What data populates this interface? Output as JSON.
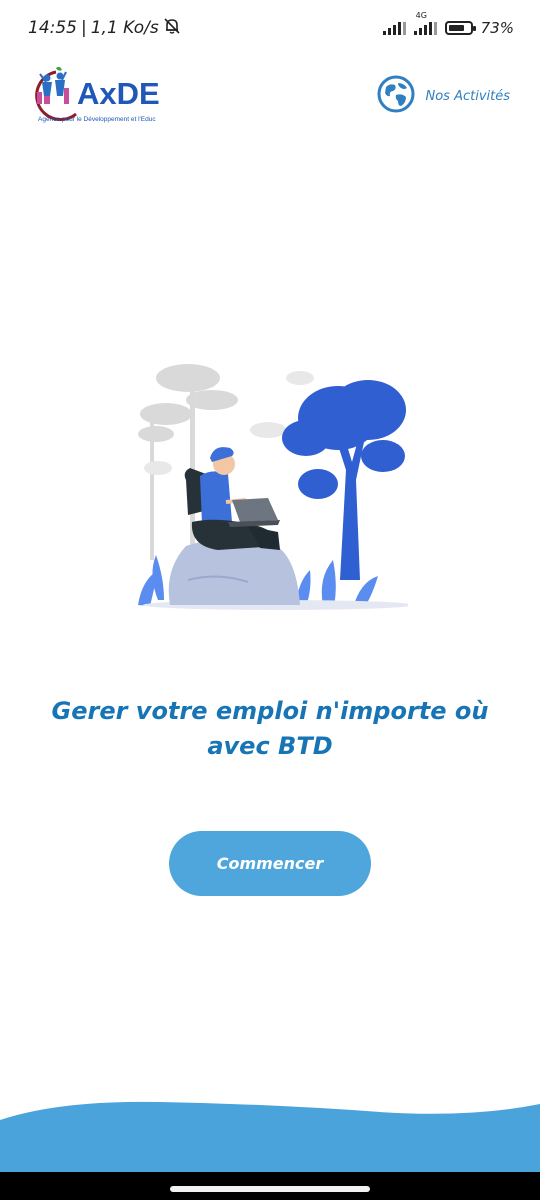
{
  "status_bar": {
    "time": "14:55",
    "separator": "|",
    "net_speed": "1,1 Ko/s",
    "network_type": "4G",
    "battery_percent": "73%",
    "battery_level": 0.73,
    "icons": [
      "bell-off-icon",
      "signal-icon",
      "lte-signal-icon",
      "battery-icon"
    ]
  },
  "header": {
    "logo_text": "AxDE",
    "logo_subtitle": "Agence pour le Développement et l'Educ",
    "activities_label": "Nos Activités",
    "activities_icon": "globe-icon"
  },
  "main": {
    "tagline": "Gerer votre emploi n'importe où avec BTD",
    "start_button": "Commencer"
  },
  "colors": {
    "primary": "#1875b5",
    "button": "#4fa6dc",
    "wave": "#4aa3da",
    "logo_blue": "#1f58b8",
    "tree_blue": "#2f5fd0"
  }
}
